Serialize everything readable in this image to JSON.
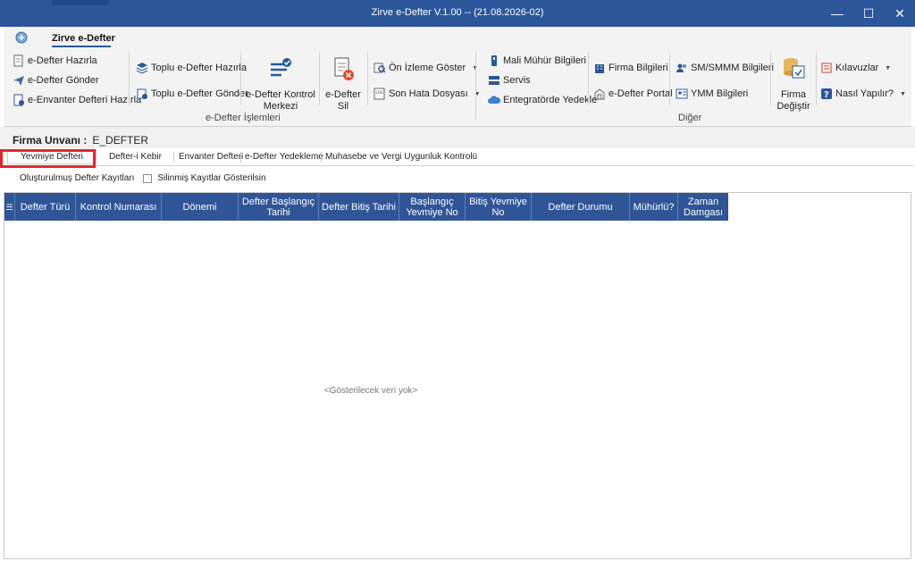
{
  "window": {
    "title": "Zirve e-Defter V.1.00  -- (21.08.2026-02)",
    "minimize": "—",
    "maximize": "☐",
    "close": "✕"
  },
  "ribbon": {
    "tab": "Zirve e-Defter",
    "group_edefter": {
      "label": "e-Defter İşlemleri",
      "edefter_hazirla": "e-Defter Hazırla",
      "edefter_gonder": "e-Defter Gönder",
      "envanter_hazirla": "e-Envanter Defteri Hazırla",
      "toplu_hazirla": "Toplu e-Defter Hazırla",
      "toplu_gonder": "Toplu e-Defter Gönder",
      "kontrol_merkezi_1": "e-Defter Kontrol",
      "kontrol_merkezi_2": "Merkezi",
      "sil_1": "e-Defter",
      "sil_2": "Sil",
      "on_izleme": "Ön İzleme Göster",
      "son_hata": "Son Hata Dosyası"
    },
    "group_diger": {
      "label": "Diğer",
      "mali_muhur": "Mali Mühür Bilgileri",
      "servis": "Servis",
      "entegrator": "Entegratörde Yedekle",
      "firma_bilgileri": "Firma Bilgileri",
      "edefter_portal": "e-Defter Portal",
      "sm_smmm": "SM/SMMM Bilgileri",
      "ymm": "YMM Bilgileri",
      "firma_degistir_1": "Firma",
      "firma_degistir_2": "Değiştir",
      "kilavuzlar": "Kılavuzlar",
      "nasil_yapilir": "Nasıl Yapılır?"
    }
  },
  "firma": {
    "label": "Firma Unvanı :",
    "value": "E_DEFTER"
  },
  "subtabs": [
    "Yevmiye Defteri",
    "Defter-i Kebir",
    "Envanter Defteri",
    "e-Defter Yedekleme",
    "Muhasebe ve Vergi Uygunluk Kontrolü"
  ],
  "filter": {
    "label": "Oluşturulmuş Defter Kayıtları",
    "checkbox_label": "Silinmiş Kayıtlar Gösterilsin"
  },
  "grid": {
    "columns": [
      "Defter Türü",
      "Kontrol Numarası",
      "Dönemi",
      "Defter Başlangıç Tarihi",
      "Defter Bitiş Tarihi",
      "Başlangıç Yevmiye No",
      "Bitiş Yevmiye No",
      "Defter Durumu",
      "Mühürlü?",
      "Zaman Damgası"
    ],
    "empty_message": "<Gösterilecek veri yok>"
  },
  "colors": {
    "titlebar": "#2b579a",
    "grid_header": "#2f5597",
    "highlight": "#e3262b"
  }
}
